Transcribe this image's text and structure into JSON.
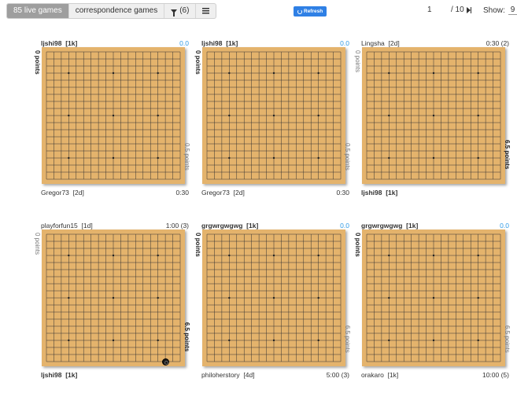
{
  "toolbar": {
    "tabs": [
      {
        "label": "85 live games",
        "active": true
      },
      {
        "label": "correspondence games",
        "active": false
      },
      {
        "label": "(6)",
        "icon": "filter-icon"
      },
      {
        "label": "",
        "icon": "list-icon"
      }
    ],
    "refresh_label": "Refresh",
    "page_current": "1",
    "page_total": "/ 10",
    "show_label": "Show:",
    "show_value": "9"
  },
  "games": [
    {
      "black": "ljshi98",
      "black_rank": "[1k]",
      "black_bold": true,
      "top_right": "0.0",
      "top_right_blue": true,
      "left_side": "0 points",
      "left_bold": true,
      "right_side": "0.5 points",
      "right_bold": false,
      "white": "Gregor73",
      "white_rank": "[2d]",
      "white_bold": false,
      "bottom_right": "0:30",
      "stones": []
    },
    {
      "black": "ljshi98",
      "black_rank": "[1k]",
      "black_bold": true,
      "top_right": "0.0",
      "top_right_blue": true,
      "left_side": "0 points",
      "left_bold": true,
      "right_side": "0.5 points",
      "right_bold": false,
      "white": "Gregor73",
      "white_rank": "[2d]",
      "white_bold": false,
      "bottom_right": "0:30",
      "stones": []
    },
    {
      "black": "Lingsha",
      "black_rank": "[2d]",
      "black_bold": false,
      "top_right": "0:30  (2)",
      "top_right_blue": false,
      "left_side": "0 points",
      "left_bold": false,
      "right_side": "6.5 points",
      "right_bold": true,
      "white": "ljshi98",
      "white_rank": "[1k]",
      "white_bold": true,
      "bottom_right": "",
      "stones": []
    },
    {
      "black": "playforfun15",
      "black_rank": "[1d]",
      "black_bold": false,
      "top_right": "1:00  (3)",
      "top_right_blue": false,
      "left_side": "0 points",
      "left_bold": false,
      "right_side": "6.5 points",
      "right_bold": true,
      "white": "ljshi98",
      "white_rank": "[1k]",
      "white_bold": true,
      "bottom_right": "",
      "stones": [
        {
          "col": 16,
          "row": 18
        }
      ]
    },
    {
      "black": "grgwrgwgwg",
      "black_rank": "[1k]",
      "black_bold": true,
      "top_right": "0.0",
      "top_right_blue": true,
      "left_side": "0 points",
      "left_bold": true,
      "right_side": "6.5 points",
      "right_bold": false,
      "white": "philoherstory",
      "white_rank": "[4d]",
      "white_bold": false,
      "bottom_right": "5:00  (3)",
      "stones": []
    },
    {
      "black": "grgwrgwgwg",
      "black_rank": "[1k]",
      "black_bold": true,
      "top_right": "0.0",
      "top_right_blue": true,
      "left_side": "0 points",
      "left_bold": true,
      "right_side": "6.5 points",
      "right_bold": false,
      "white": "orakaro",
      "white_rank": "[1k]",
      "white_bold": false,
      "bottom_right": "10:00  (5)",
      "stones": []
    }
  ],
  "board_size": 19
}
